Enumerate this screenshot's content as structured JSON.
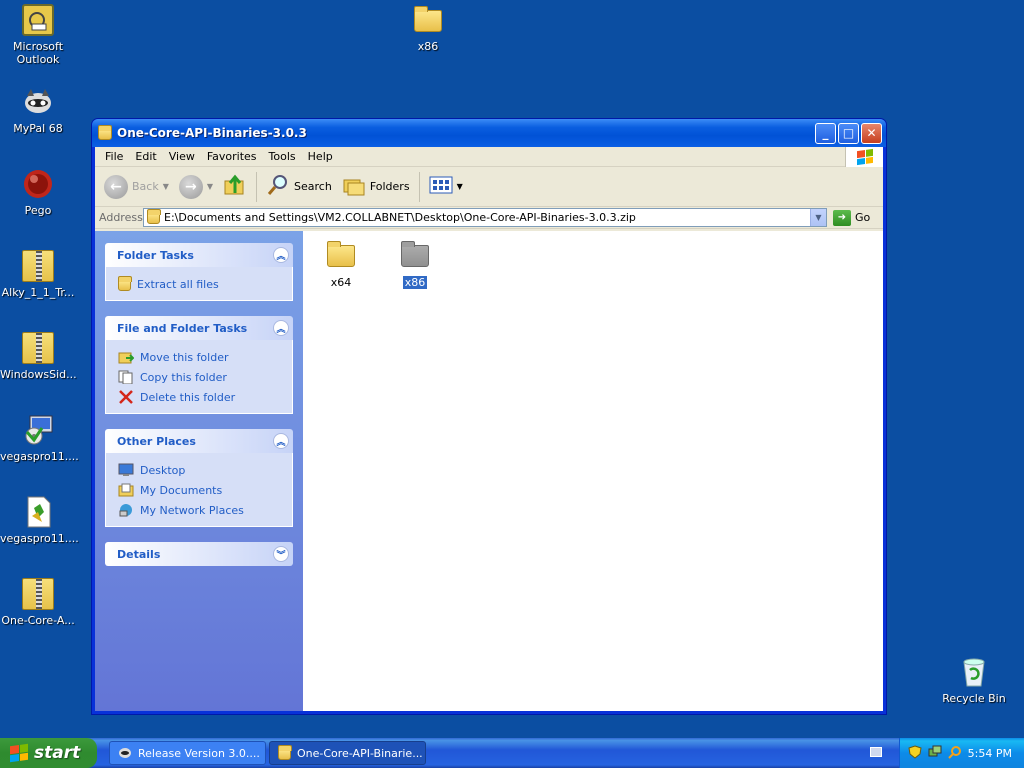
{
  "desktop": {
    "icons": [
      {
        "label": "Microsoft Outlook",
        "icon": "outlook-icon"
      },
      {
        "label": "MyPal 68",
        "icon": "raccoon-icon"
      },
      {
        "label": "Pego",
        "icon": "pego-icon"
      },
      {
        "label": "Alky_1_1_Tr...",
        "icon": "zip-icon"
      },
      {
        "label": "WindowsSid...",
        "icon": "zip-icon"
      },
      {
        "label": "vegaspro11....",
        "icon": "installer-icon"
      },
      {
        "label": "vegaspro11....",
        "icon": "script-icon"
      },
      {
        "label": "One-Core-A...",
        "icon": "zip-icon"
      },
      {
        "label": "x86",
        "icon": "folder-icon"
      },
      {
        "label": "Recycle Bin",
        "icon": "recycle-bin-icon"
      }
    ]
  },
  "window": {
    "title": "One-Core-API-Binaries-3.0.3",
    "menu": [
      "File",
      "Edit",
      "View",
      "Favorites",
      "Tools",
      "Help"
    ],
    "toolbar": {
      "back": "Back",
      "search": "Search",
      "folders": "Folders"
    },
    "address": {
      "label": "Address",
      "value": "E:\\Documents and Settings\\VM2.COLLABNET\\Desktop\\One-Core-API-Binaries-3.0.3.zip",
      "go": "Go"
    },
    "taskpane": {
      "folder_tasks": {
        "title": "Folder Tasks",
        "items": [
          "Extract all files"
        ]
      },
      "file_folder_tasks": {
        "title": "File and Folder Tasks",
        "items": [
          "Move this folder",
          "Copy this folder",
          "Delete this folder"
        ]
      },
      "other_places": {
        "title": "Other Places",
        "items": [
          "Desktop",
          "My Documents",
          "My Network Places"
        ]
      },
      "details": {
        "title": "Details"
      }
    },
    "files": [
      {
        "name": "x64",
        "selected": false
      },
      {
        "name": "x86",
        "selected": true
      }
    ]
  },
  "taskbar": {
    "start": "start",
    "tasks": [
      {
        "label": "Release Version 3.0....",
        "active": false
      },
      {
        "label": "One-Core-API-Binarie...",
        "active": true
      }
    ],
    "clock": "5:54 PM"
  },
  "colors": {
    "desktop": "#0b4ea2",
    "titlebar": "#0a5ee0",
    "taskpane_link": "#215dc6",
    "selection": "#316ac5"
  }
}
